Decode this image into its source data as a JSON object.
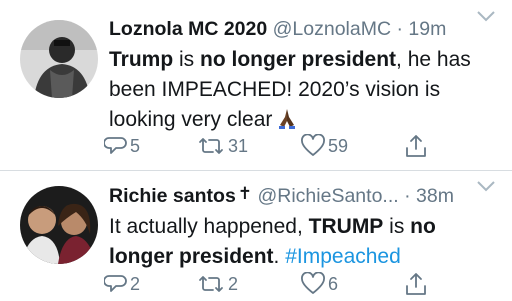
{
  "tweets": [
    {
      "name": "Loznola MC 2020",
      "verified_mark": "",
      "handle": "@LoznolaMC",
      "separator": "·",
      "time": "19m",
      "body": [
        {
          "text": "Trump",
          "style": "bold"
        },
        {
          "text": " is ",
          "style": "normal"
        },
        {
          "text": "no longer president",
          "style": "bold"
        },
        {
          "text": ", he has been IMPEACHED! 2020’s vision is looking very clear",
          "style": "normal"
        }
      ],
      "emoji_icon": "folded-hands-emoji",
      "replies": "5",
      "retweets": "31",
      "likes": "59"
    },
    {
      "name": "Richie santos",
      "verified_mark": "✝",
      "handle": "@RichieSanto...",
      "separator": "·",
      "time": "38m",
      "body": [
        {
          "text": "It actually happened, ",
          "style": "normal"
        },
        {
          "text": "TRUMP",
          "style": "bold"
        },
        {
          "text": " is ",
          "style": "normal"
        },
        {
          "text": "no longer president",
          "style": "bold"
        },
        {
          "text": ". ",
          "style": "normal"
        },
        {
          "text": "#Impeached",
          "style": "hashtag"
        }
      ],
      "replies": "2",
      "retweets": "2",
      "likes": "6"
    }
  ],
  "colors": {
    "text": "#14171a",
    "secondary": "#657786",
    "link": "#1b95e0",
    "divider": "#d8dde1",
    "background": "#ffffff"
  },
  "icons": [
    "reply-icon",
    "retweet-icon",
    "like-icon",
    "share-icon",
    "chevron-down-icon"
  ]
}
